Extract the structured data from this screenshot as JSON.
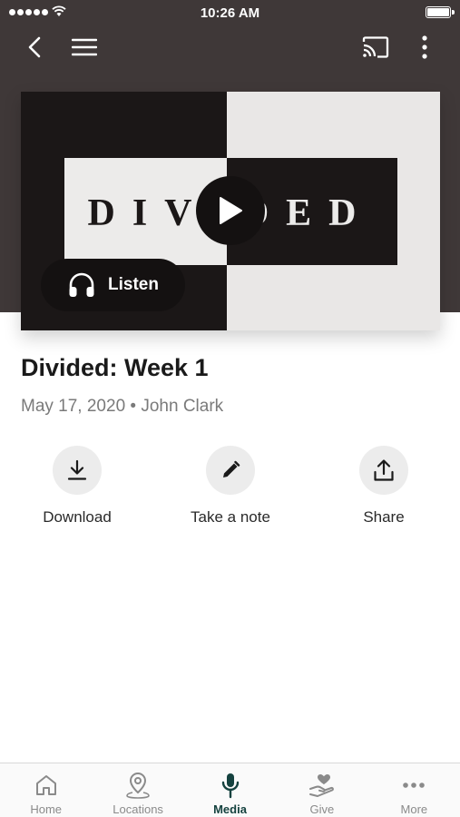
{
  "status_bar": {
    "time": "10:26 AM"
  },
  "nav": {
    "icons": [
      "back-arrow-icon",
      "menu-icon",
      "cast-icon",
      "more-vertical-icon"
    ]
  },
  "hero": {
    "art_text": "DIVIDED",
    "listen_label": "Listen"
  },
  "sermon": {
    "title": "Divided: Week 1",
    "date": "May 17, 2020",
    "separator": "•",
    "speaker": "John Clark"
  },
  "actions": [
    {
      "label": "Download",
      "icon": "download-icon"
    },
    {
      "label": "Take a note",
      "icon": "pencil-icon"
    },
    {
      "label": "Share",
      "icon": "share-icon"
    }
  ],
  "tabs": [
    {
      "label": "Home",
      "icon": "home-icon",
      "active": false
    },
    {
      "label": "Locations",
      "icon": "location-pin-icon",
      "active": false
    },
    {
      "label": "Media",
      "icon": "microphone-icon",
      "active": true
    },
    {
      "label": "Give",
      "icon": "give-heart-hand-icon",
      "active": false
    },
    {
      "label": "More",
      "icon": "more-dots-icon",
      "active": false
    }
  ],
  "colors": {
    "header_bg": "#3f3838",
    "active_tab": "#15423f",
    "inactive_tab": "#8a8a8a",
    "action_circle": "#ececec"
  }
}
